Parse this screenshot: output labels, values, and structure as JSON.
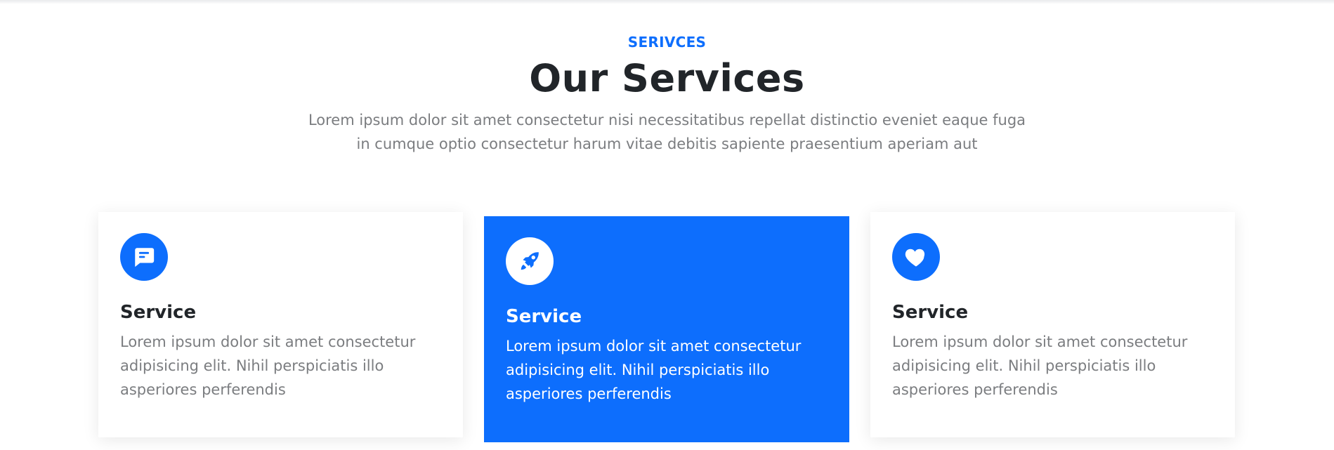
{
  "section": {
    "eyebrow": "SERIVCES",
    "title": "Our Services",
    "subtitle": "Lorem ipsum dolor sit amet consectetur nisi necessitatibus repellat distinctio eveniet eaque fuga in cumque optio consectetur harum vitae debitis sapiente praesentium aperiam aut"
  },
  "colors": {
    "accent": "#0d6efd",
    "heading": "#212529",
    "body_text": "#7b7d80",
    "card_bg": "#ffffff"
  },
  "cards": [
    {
      "icon": "chat-icon",
      "title": "Service",
      "text": "Lorem ipsum dolor sit amet consectetur adipisicing elit. Nihil perspiciatis illo asperiores perferendis",
      "active": false
    },
    {
      "icon": "rocket-icon",
      "title": "Service",
      "text": "Lorem ipsum dolor sit amet consectetur adipisicing elit. Nihil perspiciatis illo asperiores perferendis",
      "active": true
    },
    {
      "icon": "heart-icon",
      "title": "Service",
      "text": "Lorem ipsum dolor sit amet consectetur adipisicing elit. Nihil perspiciatis illo asperiores perferendis",
      "active": false
    }
  ]
}
